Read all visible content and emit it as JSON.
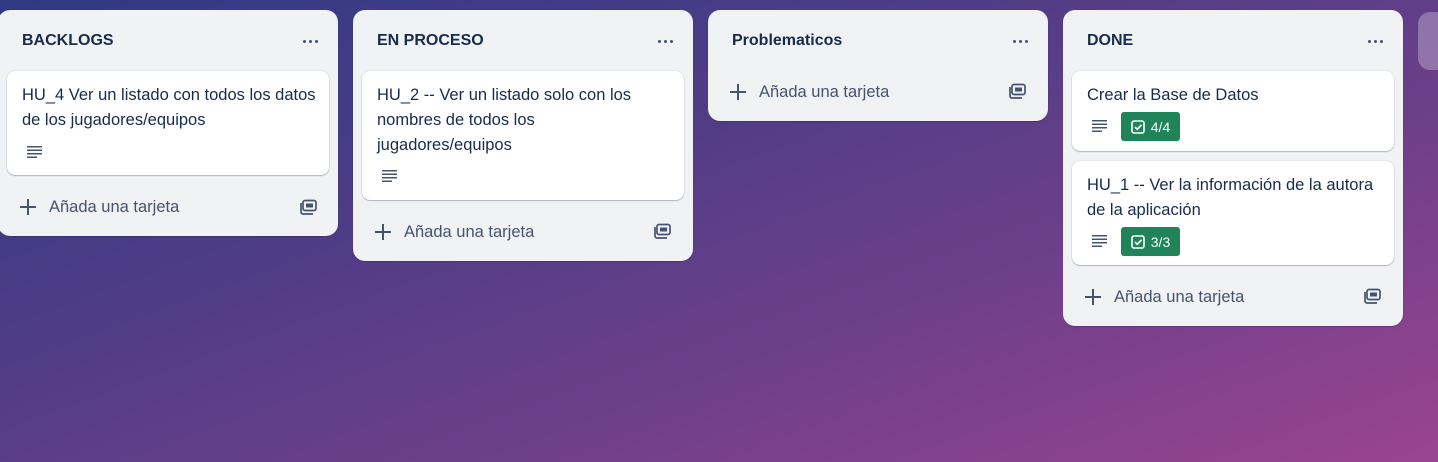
{
  "lists": [
    {
      "title": "BACKLOGS",
      "cards": [
        {
          "title": "HU_4 Ver un listado con todos los datos de los jugadores/equipos"
        }
      ],
      "add_card_label": "Añada una tarjeta"
    },
    {
      "title": "EN PROCESO",
      "cards": [
        {
          "title": "HU_2 -- Ver un listado solo con los nombres de todos los jugadores/equipos"
        }
      ],
      "add_card_label": "Añada una tarjeta"
    },
    {
      "title": "Problematicos",
      "cards": [],
      "add_card_label": "Añada una tarjeta"
    },
    {
      "title": "DONE",
      "cards": [
        {
          "title": "Crear la Base de Datos",
          "checklist": "4/4"
        },
        {
          "title": "HU_1 -- Ver la información de la autora de la aplicación",
          "checklist": "3/3"
        }
      ],
      "add_card_label": "Añada una tarjeta"
    }
  ],
  "icons": {
    "menu": "ellipsis-icon",
    "description": "description-lines-icon",
    "checklist": "checkbox-icon",
    "add": "plus-icon",
    "template": "card-template-icon"
  },
  "colors": {
    "list_bg": "#f1f2f4",
    "card_bg": "#ffffff",
    "text": "#172b4d",
    "checklist_complete": "#1f845a",
    "background_start": "#2f3a83",
    "background_end": "#9a4490"
  }
}
